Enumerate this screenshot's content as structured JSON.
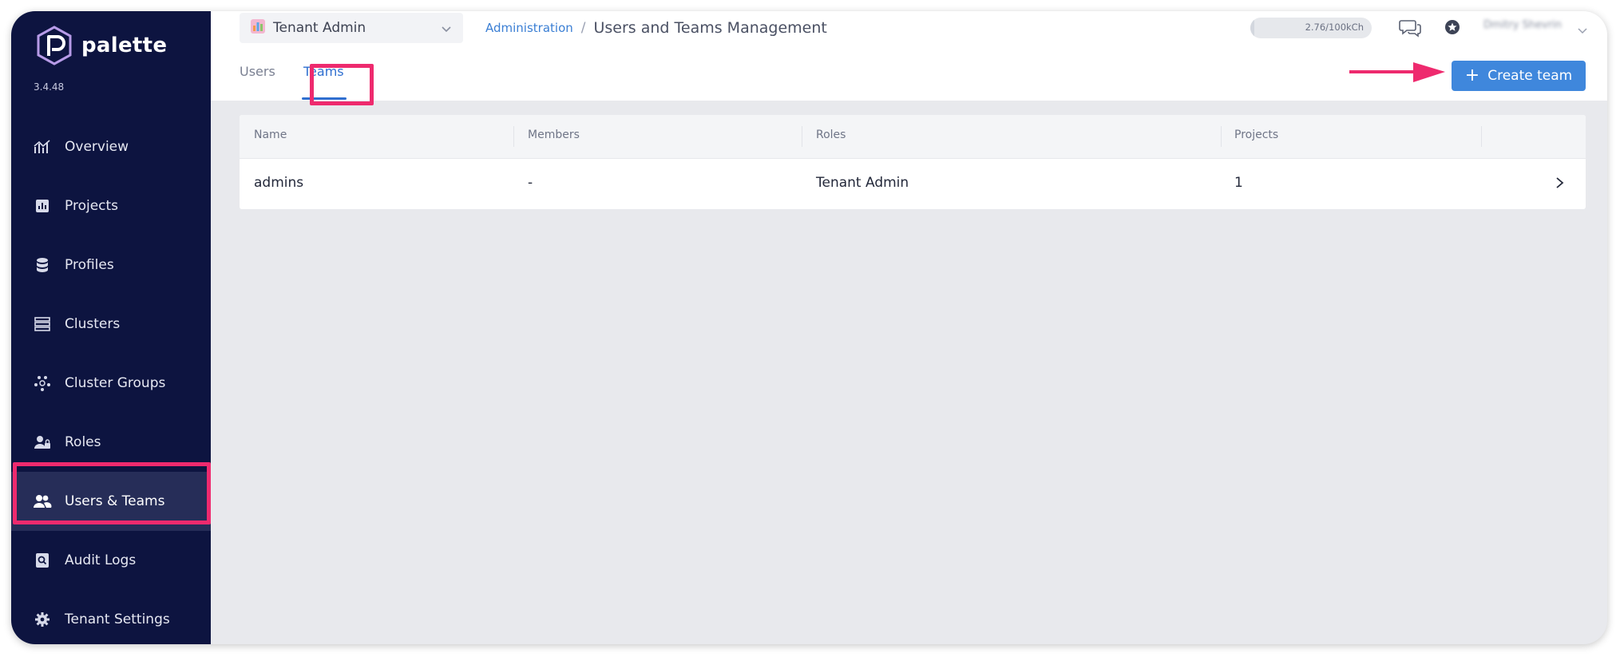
{
  "app": {
    "name": "palette",
    "version": "3.4.48"
  },
  "sidebar": {
    "items": [
      {
        "label": "Overview",
        "icon": "overview-icon"
      },
      {
        "label": "Projects",
        "icon": "projects-icon"
      },
      {
        "label": "Profiles",
        "icon": "profiles-icon"
      },
      {
        "label": "Clusters",
        "icon": "clusters-icon"
      },
      {
        "label": "Cluster Groups",
        "icon": "cluster-groups-icon"
      },
      {
        "label": "Roles",
        "icon": "roles-icon"
      },
      {
        "label": "Users & Teams",
        "icon": "users-teams-icon",
        "active": true
      },
      {
        "label": "Audit Logs",
        "icon": "audit-logs-icon"
      },
      {
        "label": "Tenant Settings",
        "icon": "gear-icon"
      }
    ]
  },
  "header": {
    "scope_label": "Tenant Admin",
    "breadcrumb_link": "Administration",
    "breadcrumb_sep": "/",
    "page_title": "Users and Teams Management",
    "credits_text": "2.76/100kCh",
    "credits_fraction": 0.03,
    "user_name": "Dmitry Shevrin"
  },
  "tabs": [
    {
      "label": "Users",
      "active": false
    },
    {
      "label": "Teams",
      "active": true
    }
  ],
  "create_button": {
    "label": "Create team",
    "icon": "plus-icon"
  },
  "table": {
    "columns": [
      "Name",
      "Members",
      "Roles",
      "Projects"
    ],
    "rows": [
      {
        "name": "admins",
        "members": "-",
        "roles": "Tenant Admin",
        "projects": "1"
      }
    ]
  },
  "colors": {
    "sidebar_bg": "#0d1440",
    "accent": "#3f87dc",
    "highlight": "#ee2a6e"
  }
}
